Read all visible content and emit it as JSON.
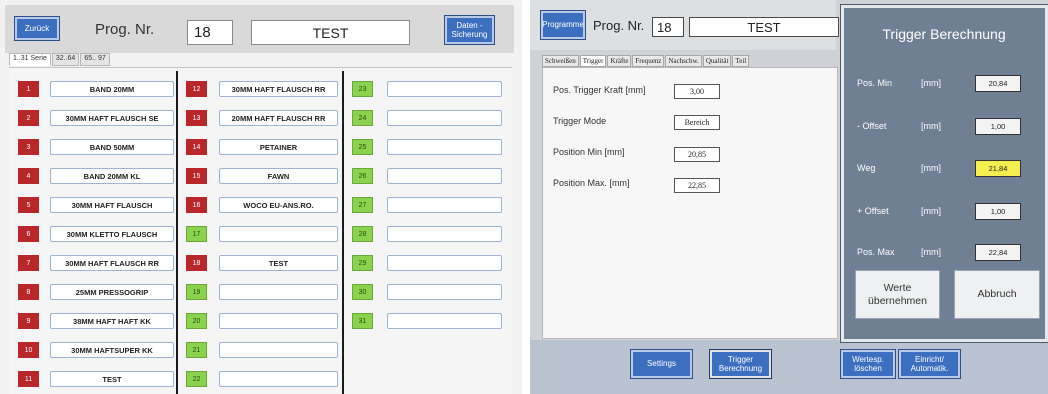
{
  "left": {
    "back_label": "Zurück",
    "prog_label": "Prog. Nr.",
    "prog_number": "18",
    "prog_name": "TEST",
    "save_label": "Daten - Sicherung",
    "tabs": [
      "1..31 Serie",
      "32..64",
      "65.. 97"
    ],
    "columns": [
      [
        {
          "num": "1",
          "name": "BAND 20MM"
        },
        {
          "num": "2",
          "name": "30MM HAFT FLAUSCH SE"
        },
        {
          "num": "3",
          "name": "BAND 50MM"
        },
        {
          "num": "4",
          "name": "BAND 20MM KL"
        },
        {
          "num": "5",
          "name": "30MM HAFT FLAUSCH"
        },
        {
          "num": "6",
          "name": "30MM KLETTO FLAUSCH"
        },
        {
          "num": "7",
          "name": "30MM HAFT FLAUSCH RR"
        },
        {
          "num": "8",
          "name": "25MM PRESSOGRIP"
        },
        {
          "num": "9",
          "name": "38MM HAFT HAFT KK"
        },
        {
          "num": "10",
          "name": "30MM HAFTSUPER KK"
        },
        {
          "num": "11",
          "name": "TEST"
        }
      ],
      [
        {
          "num": "12",
          "name": "30MM HAFT FLAUSCH RR"
        },
        {
          "num": "13",
          "name": "20MM HAFT FLAUSCH RR"
        },
        {
          "num": "14",
          "name": "PETAINER"
        },
        {
          "num": "15",
          "name": "FAWN"
        },
        {
          "num": "16",
          "name": "WOCO EU-ANS.RO."
        },
        {
          "num": "17",
          "name": ""
        },
        {
          "num": "18",
          "name": "TEST"
        },
        {
          "num": "19",
          "name": ""
        },
        {
          "num": "20",
          "name": ""
        },
        {
          "num": "21",
          "name": ""
        },
        {
          "num": "22",
          "name": ""
        }
      ],
      [
        {
          "num": "23",
          "name": ""
        },
        {
          "num": "24",
          "name": ""
        },
        {
          "num": "25",
          "name": ""
        },
        {
          "num": "26",
          "name": ""
        },
        {
          "num": "27",
          "name": ""
        },
        {
          "num": "28",
          "name": ""
        },
        {
          "num": "29",
          "name": ""
        },
        {
          "num": "30",
          "name": ""
        },
        {
          "num": "31",
          "name": ""
        }
      ]
    ]
  },
  "right": {
    "programs_label": "Programme",
    "prog_label": "Prog. Nr.",
    "prog_number": "18",
    "prog_name": "TEST",
    "tabs": [
      "Schweißen",
      "Trigger",
      "Kräfte",
      "Frequenz",
      "Nachschw.",
      "Qualität",
      "Teil"
    ],
    "active_tab": "Trigger",
    "fields": [
      {
        "label": "Pos. Trigger Kraft  [mm]",
        "value": "3,00"
      },
      {
        "label": "Trigger Mode",
        "value": "Bereich"
      },
      {
        "label": "Position Min [mm]",
        "value": "20,85"
      },
      {
        "label": "Position Max. [mm]",
        "value": "22,85"
      }
    ],
    "footer_buttons": [
      "Settings",
      "Trigger Berechnung",
      "Wertesp. löschen",
      "Einricht/ Automatik."
    ]
  },
  "dialog": {
    "title": "Trigger Berechnung",
    "rows": [
      {
        "label": "Pos. Min",
        "unit": "[mm]",
        "value": "20,84",
        "highlight": false
      },
      {
        "label": "- Offset",
        "unit": "[mm]",
        "value": "1,00",
        "highlight": false
      },
      {
        "label": "Weg",
        "unit": "[mm]",
        "value": "21,84",
        "highlight": true
      },
      {
        "label": "+ Offset",
        "unit": "[mm]",
        "value": "1,00",
        "highlight": false
      },
      {
        "label": "Pos. Max",
        "unit": "[mm]",
        "value": "22,84",
        "highlight": false
      }
    ],
    "accept_label": "Werte übernehmen",
    "cancel_label": "Abbruch"
  },
  "colors": {
    "accent_blue": "#3d6fc0",
    "slot_used": "#b9272b",
    "slot_free": "#8bd24f",
    "dialog_bg": "#6f7f94",
    "highlight_yellow": "#f4ee4e"
  }
}
